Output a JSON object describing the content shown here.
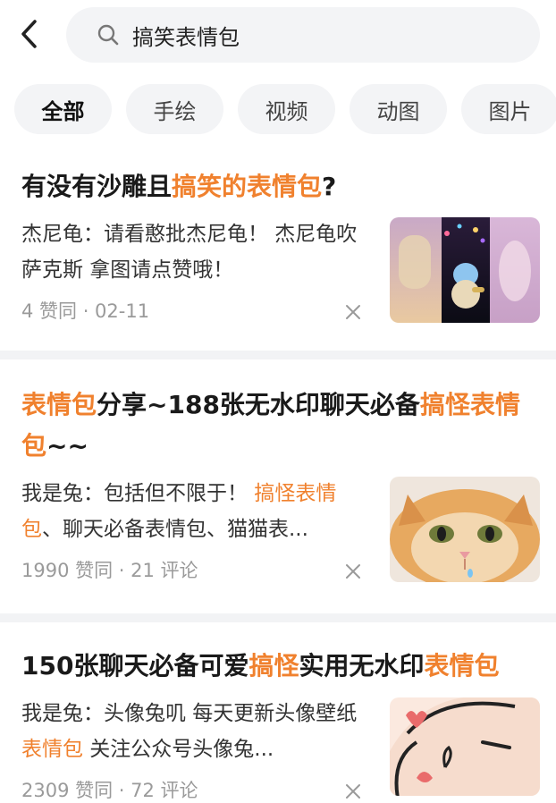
{
  "search": {
    "query": "搞笑表情包"
  },
  "tabs": [
    {
      "label": "全部",
      "active": true
    },
    {
      "label": "手绘",
      "active": false
    },
    {
      "label": "视频",
      "active": false
    },
    {
      "label": "动图",
      "active": false
    },
    {
      "label": "图片",
      "active": false
    }
  ],
  "results": [
    {
      "title_parts": [
        {
          "text": "有没有沙雕且",
          "highlight": false
        },
        {
          "text": "搞笑的表情包",
          "highlight": true
        },
        {
          "text": "?",
          "highlight": false
        }
      ],
      "snippet_parts": [
        {
          "text": "杰尼龟：请看憨批杰尼龟！ 杰尼龟吹萨克斯 拿图请点赞哦！",
          "highlight": false
        }
      ],
      "meta": "4 赞同 · 02-11",
      "thumb": "collage-cartoon"
    },
    {
      "title_parts": [
        {
          "text": "表情包",
          "highlight": true
        },
        {
          "text": "分享~188张无水印聊天必备",
          "highlight": false
        },
        {
          "text": "搞怪表情包",
          "highlight": true
        },
        {
          "text": "~~",
          "highlight": false
        }
      ],
      "snippet_parts": [
        {
          "text": "我是兔：包括但不限于！ ",
          "highlight": false
        },
        {
          "text": "搞怪表情包",
          "highlight": true
        },
        {
          "text": "、聊天必备表情包、猫猫表...",
          "highlight": false
        }
      ],
      "meta": "1990 赞同 · 21 评论",
      "thumb": "orange-cat"
    },
    {
      "title_parts": [
        {
          "text": "150张聊天必备可爱",
          "highlight": false
        },
        {
          "text": "搞怪",
          "highlight": true
        },
        {
          "text": "实用无水印",
          "highlight": false
        },
        {
          "text": "表情包",
          "highlight": true
        }
      ],
      "snippet_parts": [
        {
          "text": "我是兔：头像兔叽 每天更新头像壁纸",
          "highlight": false
        },
        {
          "text": "表情包",
          "highlight": true
        },
        {
          "text": " 关注公众号头像兔...",
          "highlight": false
        }
      ],
      "meta": "2309 赞同 · 72 评论",
      "thumb": "cartoon-face"
    }
  ],
  "colors": {
    "highlight": "#f0812e",
    "divider": "#f2f3f5",
    "chip": "#f3f4f6"
  }
}
